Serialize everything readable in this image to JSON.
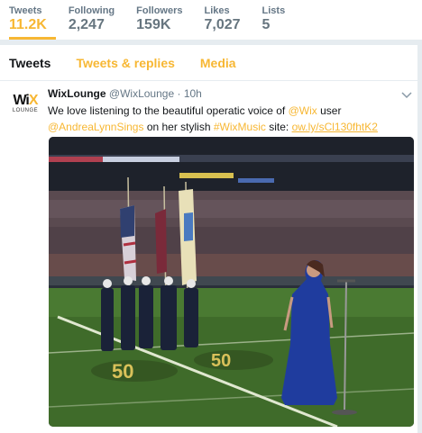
{
  "stats": [
    {
      "label": "Tweets",
      "value": "11.2K"
    },
    {
      "label": "Following",
      "value": "2,247"
    },
    {
      "label": "Followers",
      "value": "159K"
    },
    {
      "label": "Likes",
      "value": "7,027"
    },
    {
      "label": "Lists",
      "value": "5"
    }
  ],
  "tabs": [
    "Tweets",
    "Tweets & replies",
    "Media"
  ],
  "tweet": {
    "avatar_top": "WiX",
    "avatar_bottom": "LOUNGE",
    "name": "WixLounge",
    "handle": "@WixLounge",
    "dot": "·",
    "time": "10h",
    "text_1": "We love listening to the beautiful operatic voice of ",
    "mention_1": "@Wix",
    "text_2": " user",
    "mention_2": "@AndreaLynnSings",
    "text_3": " on her stylish ",
    "hashtag": "#WixMusic",
    "text_4": " site: ",
    "url": "ow.ly/sCl130fhtK2",
    "photo_numbers": [
      "50",
      "50"
    ]
  },
  "colors": {
    "accent": "#f7b733",
    "muted": "#657786",
    "field": "#3f6b2a"
  }
}
